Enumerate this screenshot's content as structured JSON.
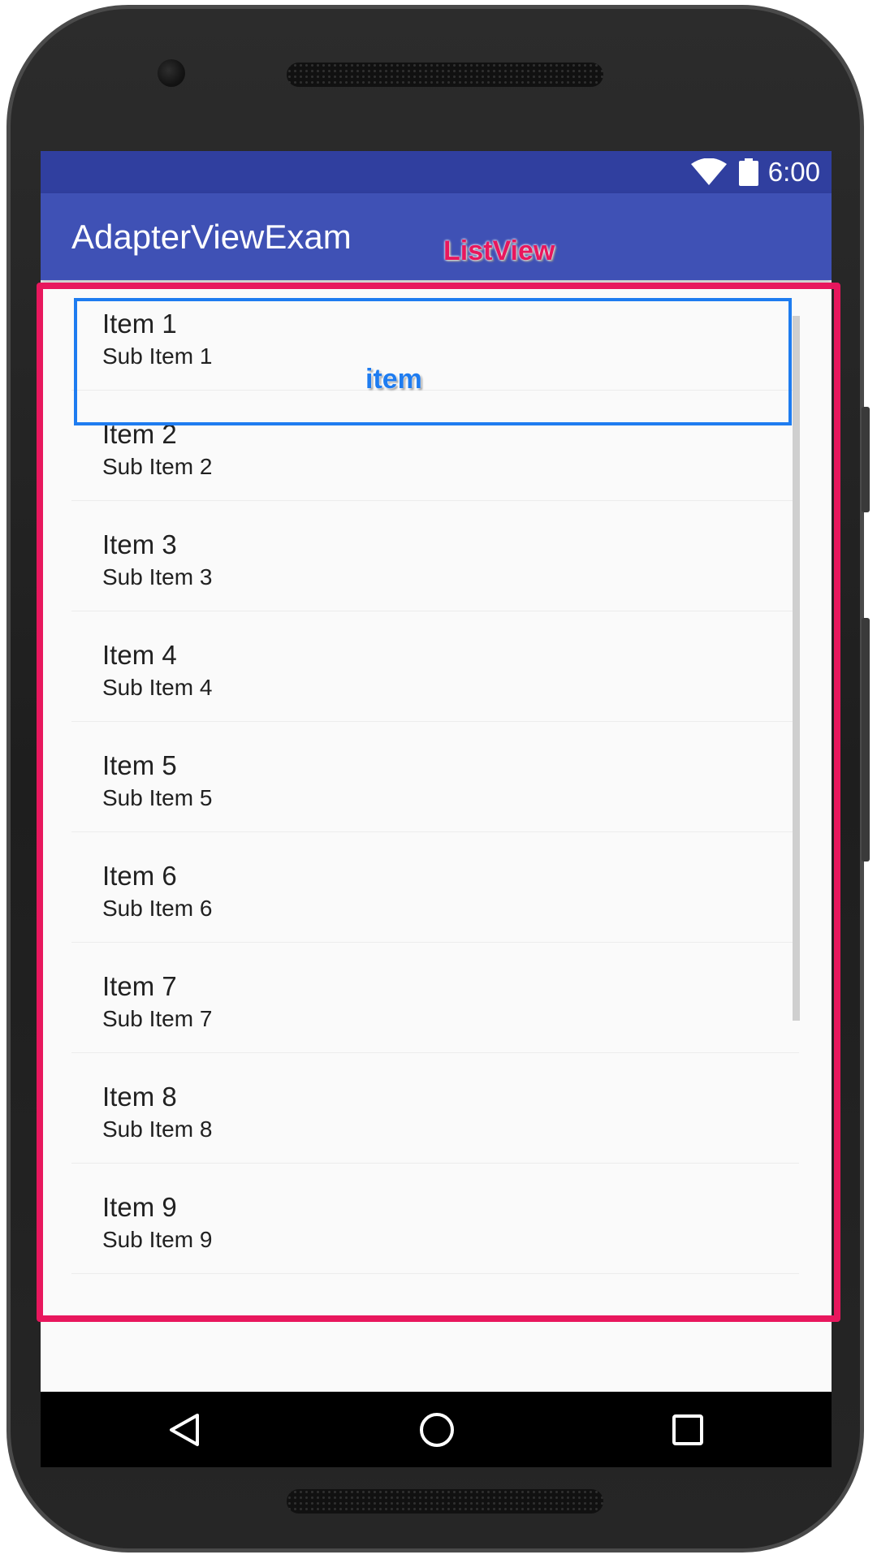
{
  "status_bar": {
    "time": "6:00",
    "icons": [
      "wifi-icon",
      "battery-icon"
    ]
  },
  "app_bar": {
    "title": "AdapterViewExam"
  },
  "list": {
    "items": [
      {
        "title": "Item 1",
        "subtitle": "Sub Item 1"
      },
      {
        "title": "Item 2",
        "subtitle": "Sub Item 2"
      },
      {
        "title": "Item 3",
        "subtitle": "Sub Item 3"
      },
      {
        "title": "Item 4",
        "subtitle": "Sub Item 4"
      },
      {
        "title": "Item 5",
        "subtitle": "Sub Item 5"
      },
      {
        "title": "Item 6",
        "subtitle": "Sub Item 6"
      },
      {
        "title": "Item 7",
        "subtitle": "Sub Item 7"
      },
      {
        "title": "Item 8",
        "subtitle": "Sub Item 8"
      },
      {
        "title": "Item 9",
        "subtitle": "Sub Item 9"
      }
    ]
  },
  "navigation": {
    "buttons": [
      "back-icon",
      "home-icon",
      "recents-icon"
    ]
  },
  "annotations": {
    "listview_label": "ListView",
    "item_label": "item"
  },
  "colors": {
    "status_bar": "#303f9f",
    "app_bar": "#3f51b5",
    "listview_annotation": "#e8175d",
    "item_annotation": "#1e7cf0"
  }
}
